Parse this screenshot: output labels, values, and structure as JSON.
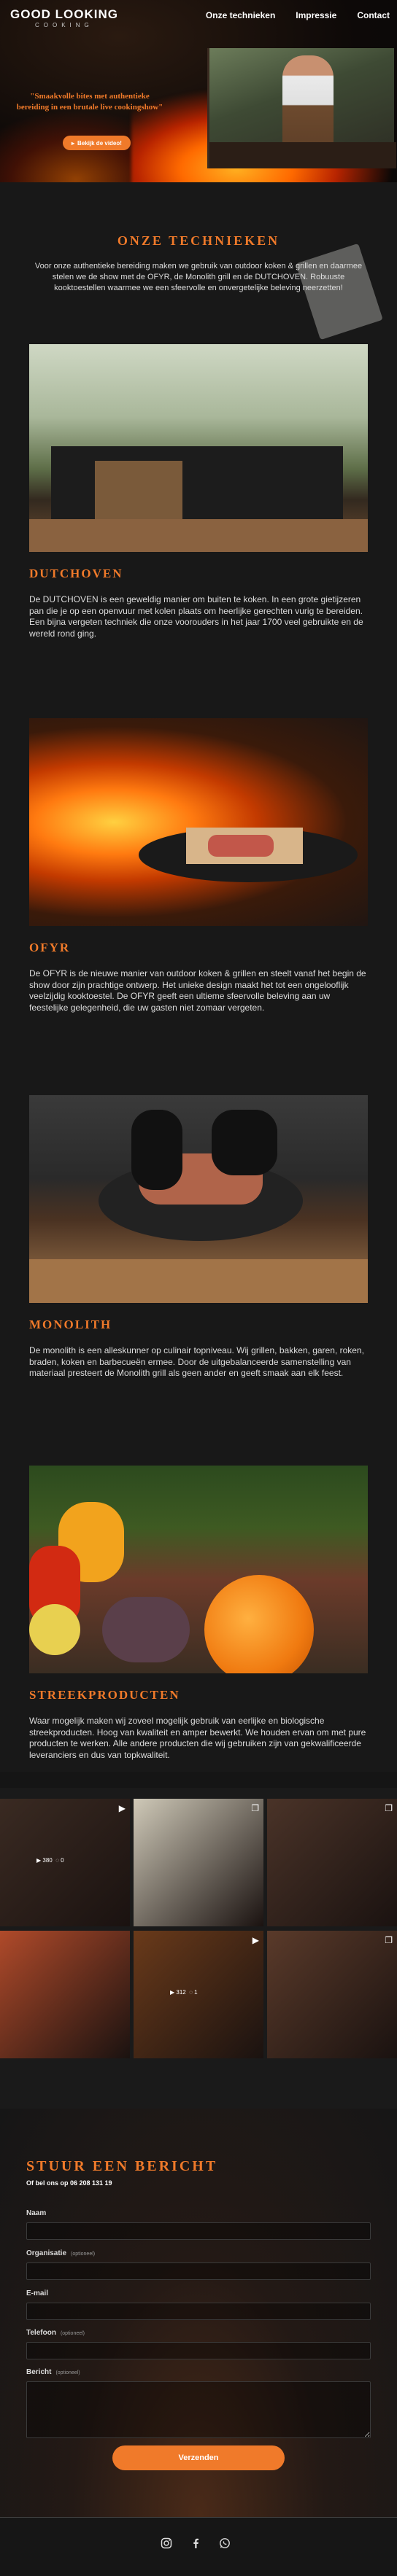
{
  "header": {
    "logo_main": "GOOD LOOKING",
    "logo_sub": "COOKING",
    "nav": [
      "Onze technieken",
      "Impressie",
      "Contact"
    ],
    "quote": "\"Smaakvolle bites met authentieke bereiding in een brutale live cookingshow\"",
    "cta": "Bekijk de video!"
  },
  "technieken": {
    "title": "ONZE TECHNIEKEN",
    "intro": "Voor onze authentieke bereiding maken we gebruik van outdoor koken & grillen en daarmee stelen we de show met de OFYR, de Monolith grill en de DUTCHOVEN. Robuuste kooktoestellen waarmee we een sfeervolle en onvergetelijke beleving neerzetten!",
    "items": [
      {
        "title": "DUTCHOVEN",
        "text": "De DUTCHOVEN is een geweldig manier om buiten te koken. In een grote gietijzeren pan die je op een openvuur met kolen plaats om heerlijke gerechten vurig te bereiden. Een bijna vergeten techniek die onze voorouders in het jaar 1700 veel gebruikte en de wereld rond ging."
      },
      {
        "title": "OFYR",
        "text": "De OFYR is de nieuwe manier van outdoor koken & grillen en steelt vanaf het begin de show door zijn prachtige ontwerp. Het unieke design maakt het tot een ongelooflijk veelzijdig kooktoestel. De OFYR geeft een ultieme sfeervolle beleving aan uw feestelijke gelegenheid, die uw gasten niet zomaar vergeten."
      },
      {
        "title": "MONOLITH",
        "text": "De monolith is een alleskunner op culinair topniveau. Wij grillen, bakken, garen, roken, braden, koken en barbecueën ermee. Door de uitgebalanceerde samenstelling van materiaal presteert de Monolith grill als geen ander en geeft smaak aan elk feest."
      },
      {
        "title": "STREEKPRODUCTEN",
        "text": "Waar mogelijk maken wij zoveel mogelijk gebruik van eerlijke en biologische streekproducten. Hoog van kwaliteit en amper bewerkt. We houden ervan om met pure producten te werken. Alle andere producten die wij gebruiken zijn van gekwalificeerde leveranciers en dus van topkwaliteit."
      }
    ]
  },
  "instagram": {
    "posts": [
      {
        "views": "380",
        "comments": "0",
        "bg": "#3a2a22"
      },
      {
        "views": "",
        "comments": "",
        "bg": "#cfc9b8"
      },
      {
        "views": "",
        "comments": "",
        "bg": "#4a3328"
      },
      {
        "views": "",
        "comments": "",
        "bg": "#b04a2a"
      },
      {
        "views": "312",
        "comments": "1",
        "bg": "#6a3a1a"
      },
      {
        "views": "",
        "comments": "",
        "bg": "#5a3a2a"
      }
    ]
  },
  "contact": {
    "title": "STUUR EEN BERICHT",
    "subtitle": "Of bel ons op 06 208 131 19",
    "fields": [
      {
        "label": "Naam",
        "optional": "",
        "type": "input"
      },
      {
        "label": "Organisatie",
        "optional": "(optioneel)",
        "type": "input"
      },
      {
        "label": "E-mail",
        "optional": "",
        "type": "input"
      },
      {
        "label": "Telefoon",
        "optional": "(optioneel)",
        "type": "input"
      },
      {
        "label": "Bericht",
        "optional": "(optioneel)",
        "type": "textarea"
      }
    ],
    "send": "Verzenden"
  },
  "footer": {
    "icons": [
      "instagram-icon",
      "facebook-icon",
      "whatsapp-icon"
    ]
  },
  "colors": {
    "accent": "#f07a2a",
    "background": "#181818"
  }
}
